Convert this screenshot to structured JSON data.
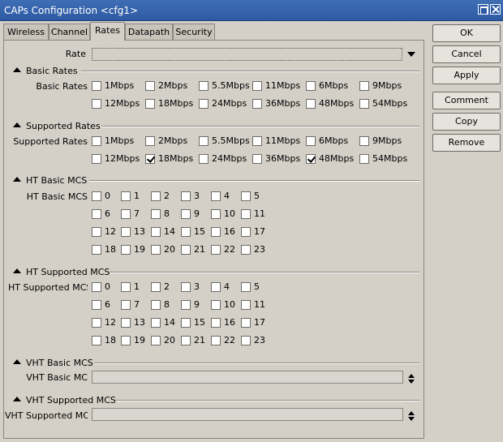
{
  "window": {
    "title": "CAPs Configuration <cfg1>"
  },
  "tabs": [
    {
      "label": "Wireless",
      "active": false
    },
    {
      "label": "Channel",
      "active": false
    },
    {
      "label": "Rates",
      "active": true
    },
    {
      "label": "Datapath",
      "active": false
    },
    {
      "label": "Security",
      "active": false
    }
  ],
  "rate": {
    "label": "Rate",
    "value": ""
  },
  "sections": {
    "basic_rates": "Basic Rates",
    "supported_rates": "Supported Rates",
    "ht_basic_mcs": "HT Basic MCS",
    "ht_supported_mcs": "HT Supported MCS",
    "vht_basic_mcs": "VHT Basic MCS",
    "vht_supported_mcs": "VHT Supported MCS"
  },
  "labels": {
    "basic_rates": "Basic Rates",
    "supported_rates": "Supported Rates",
    "ht_basic_mcs": "HT Basic MCS",
    "ht_supported_mcs": "HT Supported MCS",
    "vht_basic_mcs": "VHT Basic MC",
    "vht_supported_mcs": "VHT Supported MCS"
  },
  "rate_options": [
    "1Mbps",
    "2Mbps",
    "5.5Mbps",
    "11Mbps",
    "6Mbps",
    "9Mbps",
    "12Mbps",
    "18Mbps",
    "24Mbps",
    "36Mbps",
    "48Mbps",
    "54Mbps"
  ],
  "basic_rates_checked": [
    false,
    false,
    false,
    false,
    false,
    false,
    false,
    false,
    false,
    false,
    false,
    false
  ],
  "supported_rates_checked": [
    false,
    false,
    false,
    false,
    false,
    false,
    false,
    true,
    false,
    false,
    true,
    false
  ],
  "mcs_options": [
    "0",
    "1",
    "2",
    "3",
    "4",
    "5",
    "6",
    "7",
    "8",
    "9",
    "10",
    "11",
    "12",
    "13",
    "14",
    "15",
    "16",
    "17",
    "18",
    "19",
    "20",
    "21",
    "22",
    "23"
  ],
  "ht_basic_checked": [
    false,
    false,
    false,
    false,
    false,
    false,
    false,
    false,
    false,
    false,
    false,
    false,
    false,
    false,
    false,
    false,
    false,
    false,
    false,
    false,
    false,
    false,
    false,
    false
  ],
  "ht_supported_checked": [
    false,
    false,
    false,
    false,
    false,
    false,
    false,
    false,
    false,
    false,
    false,
    false,
    false,
    false,
    false,
    false,
    false,
    false,
    false,
    false,
    false,
    false,
    false,
    false
  ],
  "vht_basic_value": "",
  "vht_supported_value": "",
  "buttons": {
    "ok": "OK",
    "cancel": "Cancel",
    "apply": "Apply",
    "comment": "Comment",
    "copy": "Copy",
    "remove": "Remove"
  }
}
